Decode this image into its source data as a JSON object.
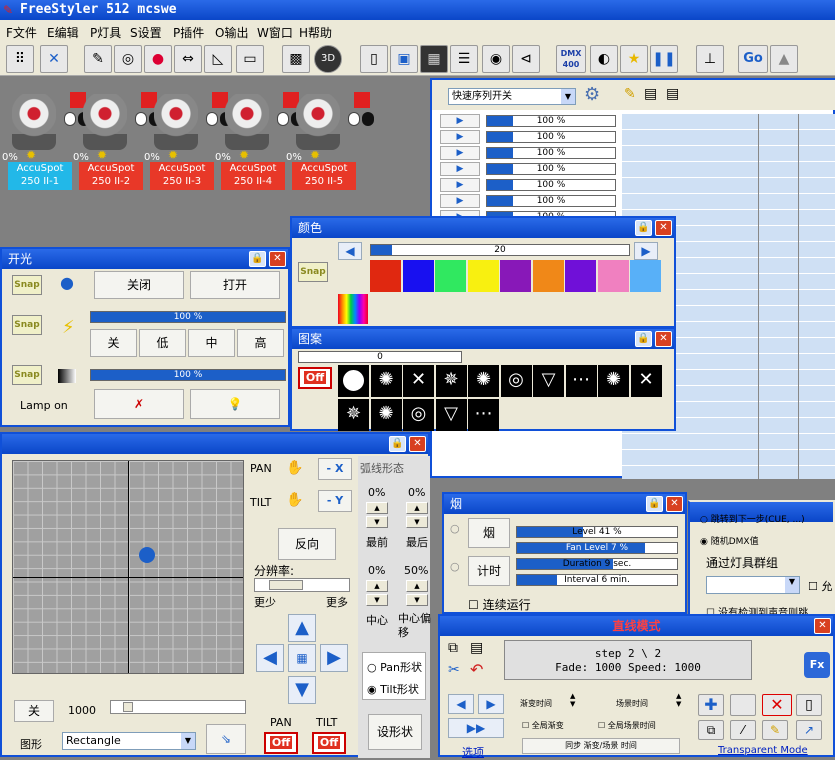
{
  "app": {
    "title": "FreeStyler 512 mcswe"
  },
  "menu": [
    "F文件",
    "E编辑",
    "P灯具",
    "S设置",
    "P插件",
    "O输出",
    "W窗口",
    "H帮助"
  ],
  "toolbar": {
    "dmx": "DMX\n400",
    "go": "Go"
  },
  "fixtures": [
    {
      "name": "AccuSpot\n250 II-1",
      "pct": "0%",
      "color": "#22b8e8"
    },
    {
      "name": "AccuSpot\n250 II-2",
      "pct": "0%",
      "color": "#e83828"
    },
    {
      "name": "AccuSpot\n250 II-3",
      "pct": "0%",
      "color": "#e83828"
    },
    {
      "name": "AccuSpot\n250 II-4",
      "pct": "0%",
      "color": "#e83828"
    },
    {
      "name": "AccuSpot\n250 II-5",
      "pct": "0%",
      "color": "#e83828"
    }
  ],
  "sequence": {
    "dropdown": "快速序列开关",
    "rows": [
      "100 %",
      "100 %",
      "100 %",
      "100 %",
      "100 %",
      "100 %",
      "100 %"
    ]
  },
  "shutter": {
    "title": "开光",
    "snap": "Snap",
    "close": "关闭",
    "open": "打开",
    "dimmer": "100 %",
    "strobe_labels": [
      "关",
      "低",
      "中",
      "高"
    ],
    "lamp_bar": "100 %",
    "lamp_on": "Lamp on"
  },
  "color": {
    "title": "颜色",
    "snap": "Snap",
    "value": "20",
    "swatches": [
      "#e02810",
      "#1810f0",
      "#30e860",
      "#f8f010",
      "#8818b8",
      "#f08818",
      "#7010d8",
      "#f080c0",
      "#58b0f8"
    ]
  },
  "gobo": {
    "title": "图案",
    "value": "0",
    "off": "Off"
  },
  "pantilt": {
    "pan": "PAN",
    "tilt": "TILT",
    "minus_x": "- X",
    "minus_y": "- Y",
    "reverse": "反向",
    "resolution": "分辨率:",
    "less": "更少",
    "more": "更多",
    "off_label": "关",
    "speed": "1000",
    "shape_label": "图形",
    "shape": "Rectangle",
    "pan_off": "Off",
    "tilt_off": "Off",
    "pan_bottom": "PAN",
    "tilt_bottom": "TILT",
    "arc": "弧线形态",
    "p1": "0%",
    "p2": "0%",
    "p3": "0%",
    "p4": "50%",
    "first": "最前",
    "last": "最后",
    "center": "中心",
    "center_offset": "中心偏\n移",
    "pan_shape": "Pan形状",
    "tilt_shape": "Tilt形状",
    "set_shape": "设形状"
  },
  "smoke": {
    "title": "烟",
    "smoke": "烟",
    "timer": "计时",
    "level": "Level 41 %",
    "fan": "Fan Level 7 %",
    "duration": "Duration 9 sec.",
    "interval": "Interval 6 min.",
    "continuous": "连续运行"
  },
  "audio": {
    "next": "跳转到下一步(CUE, ...)",
    "random": "随机DMX值",
    "group": "通过灯具群组",
    "detect": "没有检测到声音则跳",
    "allow": "允"
  },
  "cue": {
    "title": "直线模式",
    "step": "step 2 \\ 2",
    "fade": "Fade: 1000  Speed: 1000",
    "fade_time": "渐变时间",
    "scene_time": "场景时间",
    "global_fade": "全局渐变",
    "global_scene": "全局场景时间",
    "sync": "同步 渐变/场景 时间",
    "options": "选项",
    "transparent": "Transparent Mode",
    "fx": "Fx"
  }
}
